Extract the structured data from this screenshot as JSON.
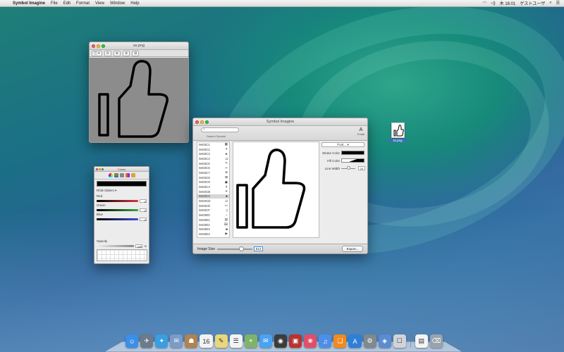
{
  "menubar": {
    "apple": "",
    "app_name": "Symbol Imagine",
    "menus": [
      "File",
      "Edit",
      "Format",
      "View",
      "Window",
      "Help"
    ],
    "clock": "木 16:01",
    "user": "ゲストユーザ"
  },
  "preview_window": {
    "title": "ss.png",
    "toolbar": [
      "◫ ▾",
      "⊖",
      "⊕",
      "⊕",
      "⊞"
    ]
  },
  "colors_window": {
    "title": "Colors",
    "mode": "RGB Sliders",
    "sliders": [
      {
        "label": "Red",
        "value": "0",
        "color": "#d83a3a"
      },
      {
        "label": "Green",
        "value": "0",
        "color": "#3aa83a"
      },
      {
        "label": "Blue",
        "value": "0",
        "color": "#3a4fd8"
      }
    ],
    "opacity_label": "Opacity",
    "opacity_value": "100",
    "opacity_unit": "%"
  },
  "main_window": {
    "title": "Symbol Imagine",
    "search_caption": "Search Symbol",
    "font_tool": "Fonts",
    "symbols": [
      {
        "code": "0e03C1",
        "glyph": "▦"
      },
      {
        "code": "0e03C2",
        "glyph": "✶"
      },
      {
        "code": "0e03C3",
        "glyph": "★"
      },
      {
        "code": "0e03C4",
        "glyph": "◘"
      },
      {
        "code": "0e03C5",
        "glyph": "✎"
      },
      {
        "code": "0e03C6",
        "glyph": "✂"
      },
      {
        "code": "0e03C7",
        "glyph": "⊛"
      },
      {
        "code": "0e03C8",
        "glyph": "⊠"
      },
      {
        "code": "0e03C9",
        "glyph": "▣"
      },
      {
        "code": "0e03CA",
        "glyph": "✝"
      },
      {
        "code": "0e03CB",
        "glyph": "✈"
      },
      {
        "code": "0e03CC",
        "glyph": "♣"
      },
      {
        "code": "0e03CD",
        "glyph": "⏻"
      },
      {
        "code": "0e03CE",
        "glyph": "▭"
      },
      {
        "code": "0e03CF",
        "glyph": "▯"
      },
      {
        "code": "0e03D0",
        "glyph": "♀"
      },
      {
        "code": "0e03D1",
        "glyph": "▤"
      },
      {
        "code": "0e03D2",
        "glyph": "⌧"
      },
      {
        "code": "0e03D3",
        "glyph": "◙"
      },
      {
        "code": "0e03D4",
        "glyph": "▶"
      },
      {
        "code": "0e03D5",
        "glyph": "◐"
      }
    ],
    "selected_index": 11,
    "font_popup": "Font...",
    "stroke_color_label": "Stroke Color",
    "fill_color_label": "Fill Color",
    "line_width_label": "Line Width",
    "line_width_value": "10",
    "image_size_label": "Image Size",
    "image_size_value": "512",
    "export_label": "Export..."
  },
  "desktop_icon": {
    "label": "ss.png"
  },
  "dock": {
    "items": [
      {
        "name": "finder",
        "glyph": "☺",
        "color": "#3b8fe6"
      },
      {
        "name": "launchpad",
        "glyph": "✈",
        "color": "#6c7a8a"
      },
      {
        "name": "safari",
        "glyph": "✦",
        "color": "#3a9ee0"
      },
      {
        "name": "mail",
        "glyph": "✉",
        "color": "#7a9cc6"
      },
      {
        "name": "contacts",
        "glyph": "☗",
        "color": "#b0834f"
      },
      {
        "name": "calendar",
        "glyph": "16",
        "color": "#f2f2f2"
      },
      {
        "name": "notes",
        "glyph": "✎",
        "color": "#e9d77a"
      },
      {
        "name": "reminders",
        "glyph": "☰",
        "color": "#f3f3f3"
      },
      {
        "name": "maps",
        "glyph": "⌖",
        "color": "#7fb36b"
      },
      {
        "name": "messages",
        "glyph": "✉",
        "color": "#4aa3f0"
      },
      {
        "name": "facetime",
        "glyph": "◉",
        "color": "#3c3c3c"
      },
      {
        "name": "photo-booth",
        "glyph": "▣",
        "color": "#b8332e"
      },
      {
        "name": "photos",
        "glyph": "❀",
        "color": "#e04f6a"
      },
      {
        "name": "itunes",
        "glyph": "♫",
        "color": "#4d8fe8"
      },
      {
        "name": "ibooks",
        "glyph": "❏",
        "color": "#f18a21"
      },
      {
        "name": "app-store",
        "glyph": "A",
        "color": "#2f7fd8"
      },
      {
        "name": "preferences",
        "glyph": "⚙",
        "color": "#808890"
      },
      {
        "name": "preview",
        "glyph": "◈",
        "color": "#5b8bd1"
      },
      {
        "name": "symbol-imagine",
        "glyph": "☐",
        "color": "#d0d4da"
      }
    ],
    "right_items": [
      {
        "name": "document",
        "glyph": "▤",
        "color": "#f4f4f4"
      },
      {
        "name": "trash",
        "glyph": "⌫",
        "color": "#9aa3ad"
      }
    ]
  }
}
